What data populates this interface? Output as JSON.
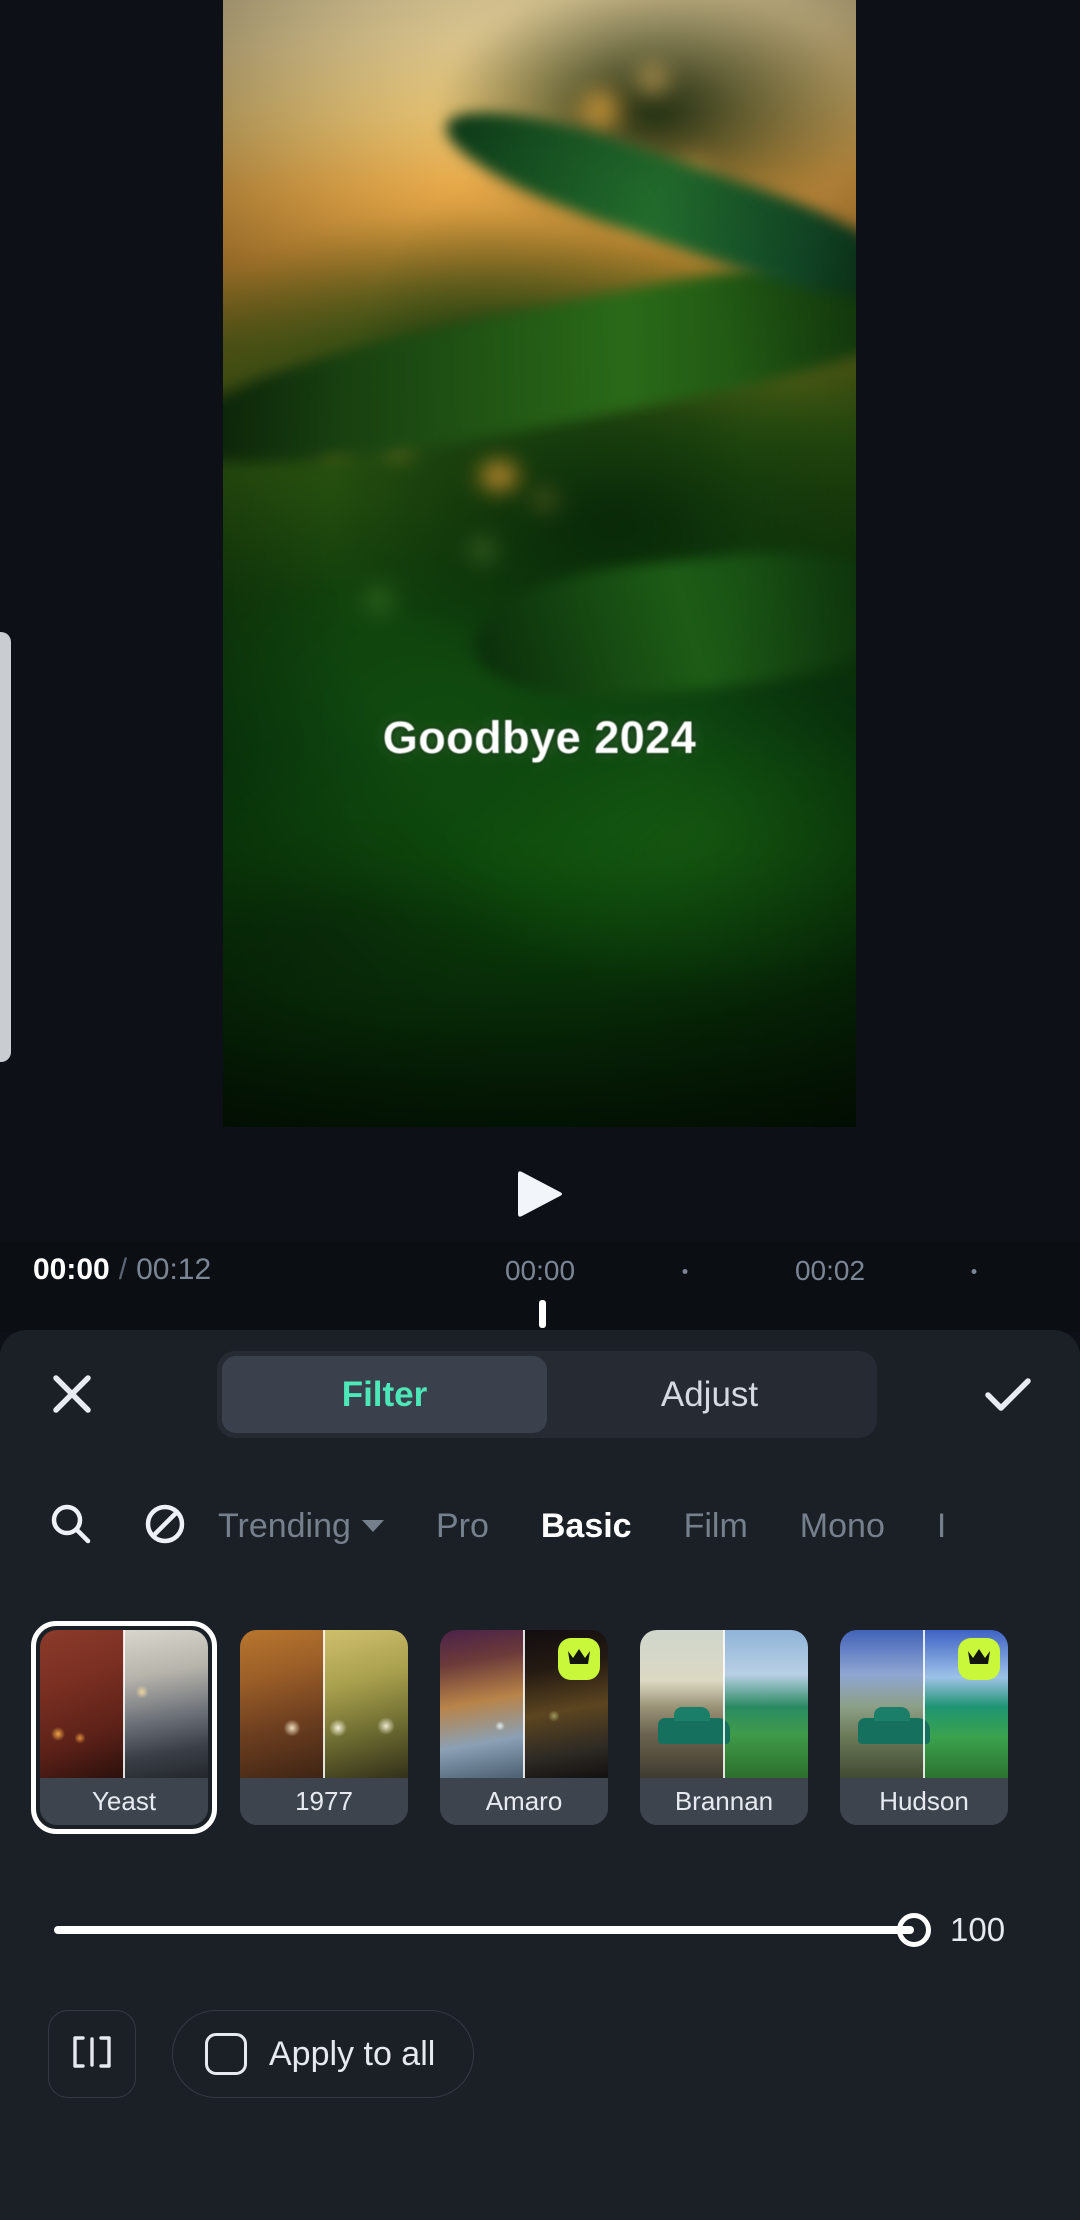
{
  "preview": {
    "caption": "Goodbye 2024",
    "play_icon": "play-icon",
    "drawer_handle": "drawer-handle"
  },
  "timeline": {
    "current_time": "00:00",
    "separator": "/",
    "total_time": "00:12",
    "ruler_labels": [
      "00:00",
      "00:02"
    ],
    "ruler_dots": 2
  },
  "sheet": {
    "close_icon": "close-icon",
    "confirm_icon": "check-icon",
    "tabs": [
      {
        "label": "Filter",
        "active": true
      },
      {
        "label": "Adjust",
        "active": false
      }
    ],
    "active_tab_color": "#4de8b8"
  },
  "categories": {
    "search_icon": "search-icon",
    "none_icon": "no-filter-icon",
    "items": [
      {
        "label": "Trending",
        "active": false,
        "has_caret": true
      },
      {
        "label": "Pro",
        "active": false,
        "has_caret": false
      },
      {
        "label": "Basic",
        "active": true,
        "has_caret": false
      },
      {
        "label": "Film",
        "active": false,
        "has_caret": false
      },
      {
        "label": "Mono",
        "active": false,
        "has_caret": false
      },
      {
        "label": "I",
        "active": false,
        "has_caret": false
      }
    ]
  },
  "filters": [
    {
      "label": "Yeast",
      "selected": true,
      "pro": false
    },
    {
      "label": "1977",
      "selected": false,
      "pro": false
    },
    {
      "label": "Amaro",
      "selected": false,
      "pro": true
    },
    {
      "label": "Brannan",
      "selected": false,
      "pro": false
    },
    {
      "label": "Hudson",
      "selected": false,
      "pro": true
    }
  ],
  "intensity": {
    "value": "100",
    "percent": 100
  },
  "bottom": {
    "compare_icon": "compare-split-icon",
    "apply_all_label": "Apply to all",
    "apply_all_checked": false
  },
  "colors": {
    "page_bg": "#0d1117",
    "sheet_bg": "#1b1f26",
    "accent": "#4de8b8",
    "pro_badge": "#c9f73a"
  }
}
